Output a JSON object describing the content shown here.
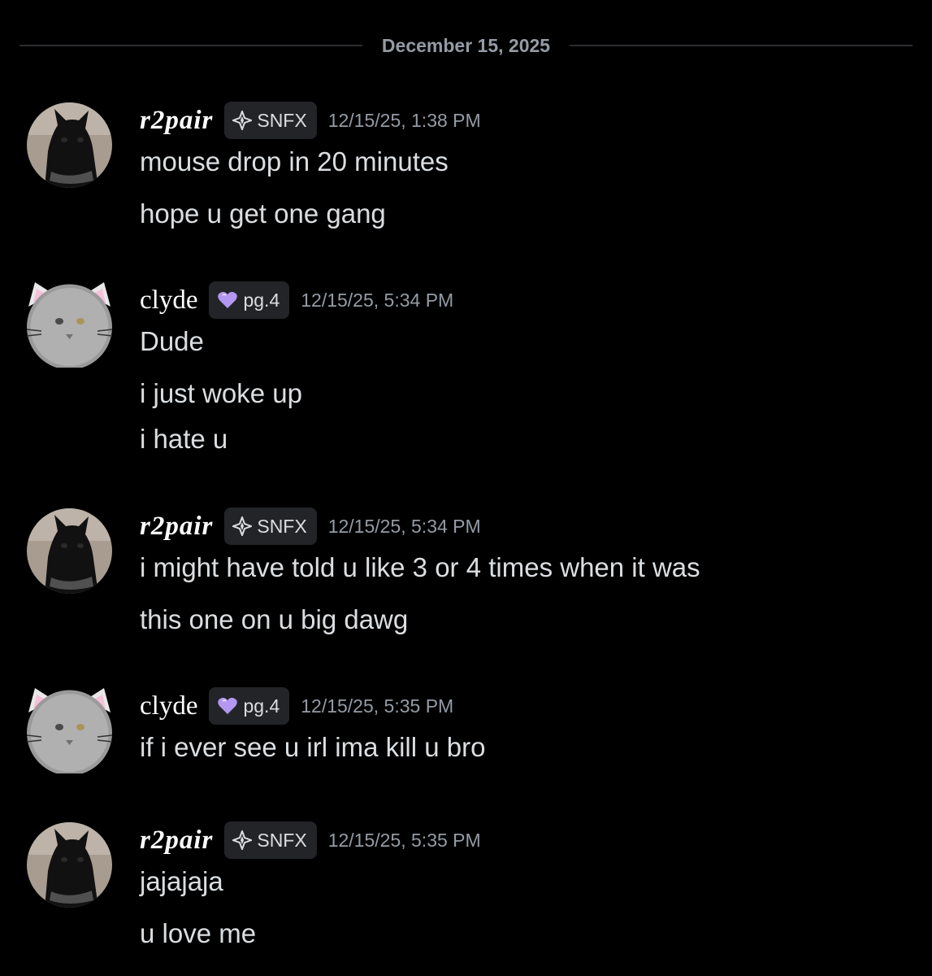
{
  "date_divider": "December 15, 2025",
  "messages": [
    {
      "author": "r2pair",
      "tag": "SNFX",
      "tag_icon": "diamond-icon",
      "timestamp": "12/15/25, 1:38 PM",
      "lines": [
        "mouse drop in 20 minutes",
        "hope u get one gang"
      ]
    },
    {
      "author": "clyde",
      "tag": "pg.4",
      "tag_icon": "heart-icon",
      "timestamp": "12/15/25, 5:34 PM",
      "lines": [
        "Dude",
        "i just woke up",
        "i hate u"
      ]
    },
    {
      "author": "r2pair",
      "tag": "SNFX",
      "tag_icon": "diamond-icon",
      "timestamp": "12/15/25, 5:34 PM",
      "lines": [
        "i might have told u like 3 or 4 times when it was",
        "this one on u big dawg"
      ]
    },
    {
      "author": "clyde",
      "tag": "pg.4",
      "tag_icon": "heart-icon",
      "timestamp": "12/15/25, 5:35 PM",
      "lines": [
        "if i ever see u irl ima kill u bro"
      ]
    },
    {
      "author": "r2pair",
      "tag": "SNFX",
      "tag_icon": "diamond-icon",
      "timestamp": "12/15/25, 5:35 PM",
      "lines": [
        "jajajaja",
        "u love me"
      ]
    }
  ],
  "colors": {
    "background": "#000000",
    "text": "#dbdee1",
    "muted": "#949ba4",
    "tag_bg": "#232428",
    "heart": "#b497f0"
  }
}
